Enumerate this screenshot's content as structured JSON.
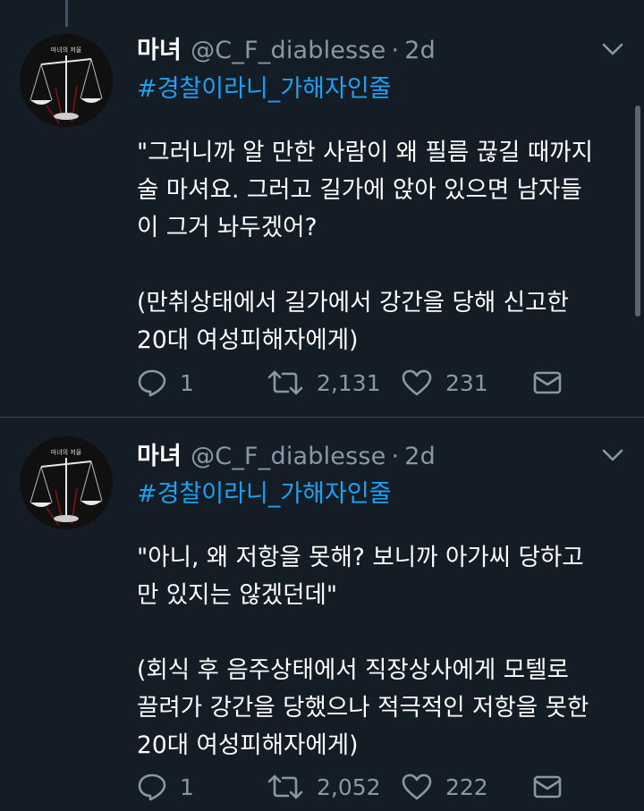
{
  "tweets": [
    {
      "name": "마녀",
      "handle": "@C_F_diablesse",
      "separator": "·",
      "time": "2d",
      "hashtag": "#경찰이라니_가해자인줄",
      "quote": "\"그러니까 알 만한 사람이 왜 필름 끊길 때까지\n술 마셔요. 그러고 길가에 앉아 있으면 남자들\n이 그거 놔두겠어?",
      "context": "(만취상태에서 길가에서 강간을 당해 신고한\n20대 여성피해자에게)",
      "replies": "1",
      "retweets": "2,131",
      "likes": "231",
      "avatar_text": "마녀의 저울"
    },
    {
      "name": "마녀",
      "handle": "@C_F_diablesse",
      "separator": "·",
      "time": "2d",
      "hashtag": "#경찰이라니_가해자인줄",
      "quote": "\"아니, 왜 저항을 못해? 보니까 아가씨 당하고\n만 있지는 않겠던데\"",
      "context": "(회식 후 음주상태에서 직장상사에게 모텔로\n끌려가 강간을 당했으나 적극적인 저항을 못한\n20대 여성피해자에게)",
      "replies": "1",
      "retweets": "2,052",
      "likes": "222",
      "avatar_text": "마녀의 저울"
    }
  ],
  "icons": {
    "reply": "reply-icon",
    "retweet": "retweet-icon",
    "like": "heart-icon",
    "dm": "envelope-icon",
    "menu": "chevron-down-icon"
  },
  "colors": {
    "background": "#141d26",
    "link": "#1da1f2",
    "secondary": "#8899a6"
  }
}
